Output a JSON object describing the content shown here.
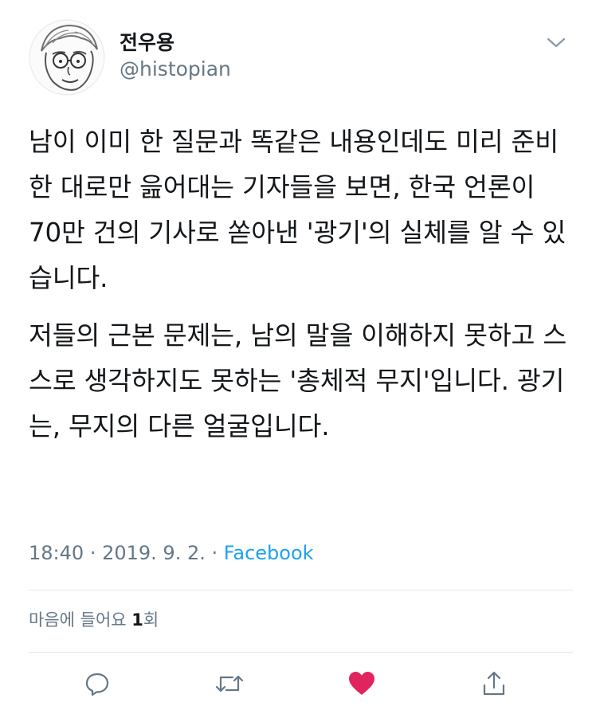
{
  "user": {
    "display_name": "전우용",
    "handle": "@histopian",
    "avatar_icon": "sketched-portrait-avatar"
  },
  "tweet": {
    "paragraphs": [
      "남이 이미 한 질문과 똑같은 내용인데도 미리 준비한 대로만 읊어대는 기자들을 보면, 한국 언론이 70만 건의 기사로 쏟아낸 '광기'의 실체를 알 수 있습니다.",
      "저들의 근본 문제는, 남의 말을 이해하지 못하고 스스로 생각하지도 못하는 '총체적 무지'입니다. 광기는, 무지의 다른 얼굴입니다."
    ]
  },
  "meta": {
    "time": "18:40",
    "separator": "·",
    "date": "2019. 9. 2.",
    "source": "Facebook"
  },
  "likes": {
    "prefix": "마음에 들어요 ",
    "count": "1",
    "suffix": "회"
  },
  "actions": {
    "reply_icon": "comment-icon",
    "retweet_icon": "retweet-icon",
    "like_icon": "heart-icon",
    "share_icon": "share-icon"
  },
  "colors": {
    "text": "#14171a",
    "secondary": "#657786",
    "link": "#1da1f2",
    "heart": "#e0245e",
    "divider": "#e1e8ed"
  }
}
